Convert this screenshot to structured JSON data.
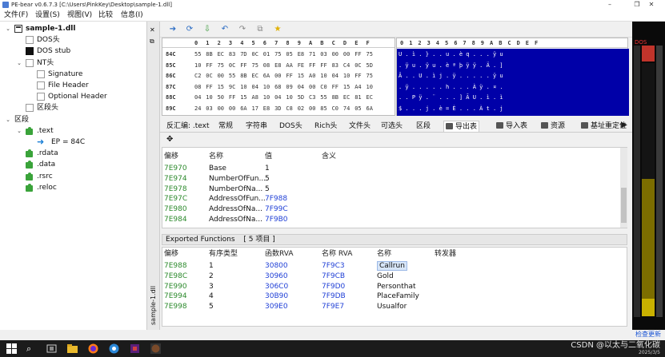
{
  "window": {
    "title": "PE-bear v0.6.7.3 [C:\\Users\\PinkKey\\Desktop\\sample-1.dll]",
    "controls": [
      "–",
      "❐",
      "✕"
    ]
  },
  "menu": [
    "文件(F)",
    "设置(S)",
    "视图(V)",
    "比较",
    "信息(I)"
  ],
  "tree": [
    {
      "label": "sample-1.dll",
      "indent": 0,
      "caret": "⌄",
      "icon": "doc",
      "bold": true
    },
    {
      "label": "DOS头",
      "indent": 1,
      "caret": "",
      "icon": "blank"
    },
    {
      "label": "DOS stub",
      "indent": 1,
      "caret": "",
      "icon": "black"
    },
    {
      "label": "NT头",
      "indent": 1,
      "caret": "⌄",
      "icon": "blank"
    },
    {
      "label": "Signature",
      "indent": 2,
      "caret": "",
      "icon": "blank"
    },
    {
      "label": "File Header",
      "indent": 2,
      "caret": "",
      "icon": "blank"
    },
    {
      "label": "Optional Header",
      "indent": 2,
      "caret": "",
      "icon": "blank"
    },
    {
      "label": "区段头",
      "indent": 1,
      "caret": "",
      "icon": "blank"
    },
    {
      "label": "区段",
      "indent": 0,
      "caret": "⌄",
      "icon": "none"
    },
    {
      "label": ".text",
      "indent": 1,
      "caret": "⌄",
      "icon": "puzzle"
    },
    {
      "label": "EP = 84C",
      "indent": 2,
      "caret": "",
      "icon": "arrow"
    },
    {
      "label": ".rdata",
      "indent": 1,
      "caret": "",
      "icon": "puzzle"
    },
    {
      "label": ".data",
      "indent": 1,
      "caret": "",
      "icon": "puzzle"
    },
    {
      "label": ".rsrc",
      "indent": 1,
      "caret": "",
      "icon": "puzzle"
    },
    {
      "label": ".reloc",
      "indent": 1,
      "caret": "",
      "icon": "puzzle"
    }
  ],
  "side_label": "sample-1.dll",
  "toolbar_icons": [
    "arrow-right-icon",
    "reload-icon",
    "export-icon",
    "undo-icon",
    "redo-icon",
    "window-icon",
    "star-icon"
  ],
  "hex": {
    "columns": [
      "0",
      "1",
      "2",
      "3",
      "4",
      "5",
      "6",
      "7",
      "8",
      "9",
      "A",
      "B",
      "C",
      "D",
      "E",
      "F"
    ],
    "rows": [
      {
        "addr": "84C",
        "bytes": [
          "55",
          "8B",
          "EC",
          "83",
          "7D",
          "0C",
          "01",
          "75",
          "05",
          "E8",
          "71",
          "03",
          "00",
          "00",
          "FF",
          "75"
        ]
      },
      {
        "addr": "85C",
        "bytes": [
          "10",
          "FF",
          "75",
          "0C",
          "FF",
          "75",
          "08",
          "E8",
          "AA",
          "FE",
          "FF",
          "FF",
          "83",
          "C4",
          "0C",
          "5D"
        ]
      },
      {
        "addr": "86C",
        "bytes": [
          "C2",
          "0C",
          "00",
          "55",
          "8B",
          "EC",
          "6A",
          "00",
          "FF",
          "15",
          "A0",
          "10",
          "04",
          "10",
          "FF",
          "75"
        ]
      },
      {
        "addr": "87C",
        "bytes": [
          "08",
          "FF",
          "15",
          "9C",
          "10",
          "04",
          "10",
          "68",
          "09",
          "04",
          "00",
          "C0",
          "FF",
          "15",
          "A4",
          "10"
        ]
      },
      {
        "addr": "88C",
        "bytes": [
          "04",
          "10",
          "50",
          "FF",
          "15",
          "A8",
          "10",
          "04",
          "10",
          "5D",
          "C3",
          "55",
          "8B",
          "EC",
          "81",
          "EC"
        ]
      },
      {
        "addr": "89C",
        "bytes": [
          "24",
          "03",
          "00",
          "00",
          "6A",
          "17",
          "E8",
          "3D",
          "C8",
          "02",
          "00",
          "85",
          "C0",
          "74",
          "05",
          "6A"
        ]
      }
    ],
    "ascii_lines": [
      "U . ì . } . . u . è q . . . ÿ u",
      ". ÿ u . ÿ u . è ª þ ÿ ÿ . Ä . ]",
      "Â . . U . ì j . ÿ . . . . . ÿ u",
      ". ÿ . . . . . h . . . À ÿ . ¤ .",
      ". . P ÿ . ¨ . . . ] Ã U . ì . ì",
      "$ . . . j . è = È . . . À t . j"
    ]
  },
  "tabs": [
    {
      "label": "反汇编: .text",
      "icon": false
    },
    {
      "label": "常规",
      "icon": false
    },
    {
      "label": "字符串",
      "icon": false
    },
    {
      "label": "DOS头",
      "icon": false
    },
    {
      "label": "Rich头",
      "icon": false
    },
    {
      "label": "文件头",
      "icon": false
    },
    {
      "label": "可选头",
      "icon": false
    },
    {
      "label": "区段",
      "icon": false
    },
    {
      "label": "导出表",
      "icon": true,
      "active": true
    },
    {
      "label": "导入表",
      "icon": true
    },
    {
      "label": "资源",
      "icon": true
    },
    {
      "label": "基址重定位",
      "icon": true
    }
  ],
  "export_header": {
    "columns": [
      "偏移",
      "名称",
      "值",
      "含义"
    ],
    "rows": [
      {
        "offset": "7E970",
        "name": "Base",
        "value": "1",
        "meaning": ""
      },
      {
        "offset": "7E974",
        "name": "NumberOfFun...",
        "value": "5",
        "meaning": ""
      },
      {
        "offset": "7E978",
        "name": "NumberOfNa...",
        "value": "5",
        "meaning": ""
      },
      {
        "offset": "7E97C",
        "name": "AddressOfFun...",
        "value": "7F988",
        "meaning": ""
      },
      {
        "offset": "7E980",
        "name": "AddressOfNa...",
        "value": "7F99C",
        "meaning": ""
      },
      {
        "offset": "7E984",
        "name": "AddressOfNa...",
        "value": "7F9B0",
        "meaning": ""
      }
    ]
  },
  "exported_functions": {
    "title": "Exported Functions",
    "count": "[ 5 项目 ]",
    "columns": [
      "偏移",
      "有序类型",
      "函数RVA",
      "名称 RVA",
      "名称",
      "转发器"
    ],
    "rows": [
      {
        "offset": "7E988",
        "ordinal": "1",
        "func_rva": "30800",
        "name_rva": "7F9C3",
        "name": "Callrun",
        "forwarder": ""
      },
      {
        "offset": "7E98C",
        "ordinal": "2",
        "func_rva": "30960",
        "name_rva": "7F9CB",
        "name": "Gold",
        "forwarder": ""
      },
      {
        "offset": "7E990",
        "ordinal": "3",
        "func_rva": "306C0",
        "name_rva": "7F9D0",
        "name": "Personthat",
        "forwarder": ""
      },
      {
        "offset": "7E994",
        "ordinal": "4",
        "func_rva": "30B90",
        "name_rva": "7F9DB",
        "name": "PlaceFamily",
        "forwarder": ""
      },
      {
        "offset": "7E998",
        "ordinal": "5",
        "func_rva": "309E0",
        "name_rva": "7F9E7",
        "name": "Usualfor",
        "forwarder": ""
      }
    ]
  },
  "right_panel": {
    "top_label": "DOS",
    "bottom_link": "检查更新"
  },
  "taskbar": {
    "icons": [
      "windows-icon",
      "search-icon",
      "task-view-icon",
      "file-explorer-icon",
      "firefox-icon",
      "app-icon-1",
      "app-icon-2",
      "app-icon-3"
    ],
    "watermark": "CSDN @以太与二氧化碳",
    "date": "2025/3/5"
  },
  "colors": {
    "offset_green": "#2c8a2c",
    "value_blue": "#1f3fd6",
    "ascii_bg": "#0000a8",
    "map_yellow": "#c9b100",
    "map_red": "#c0342b"
  }
}
